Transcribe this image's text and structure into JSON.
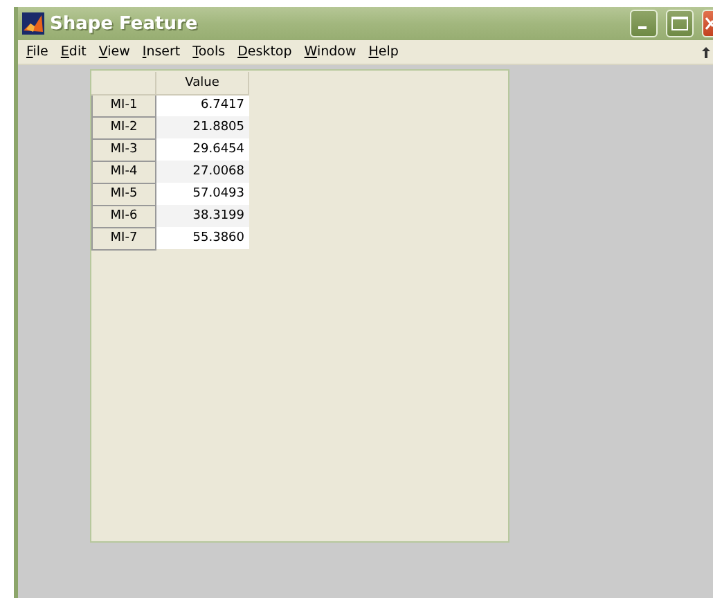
{
  "window": {
    "title": "Shape Feature"
  },
  "menu": [
    "File",
    "Edit",
    "View",
    "Insert",
    "Tools",
    "Desktop",
    "Window",
    "Help"
  ],
  "table": {
    "columns": [
      "Value"
    ],
    "rows": [
      {
        "label": "MI-1",
        "value": "6.7417"
      },
      {
        "label": "MI-2",
        "value": "21.8805"
      },
      {
        "label": "MI-3",
        "value": "29.6454"
      },
      {
        "label": "MI-4",
        "value": "27.0068"
      },
      {
        "label": "MI-5",
        "value": "57.0493"
      },
      {
        "label": "MI-6",
        "value": "38.3199"
      },
      {
        "label": "MI-7",
        "value": "55.3860"
      }
    ]
  }
}
